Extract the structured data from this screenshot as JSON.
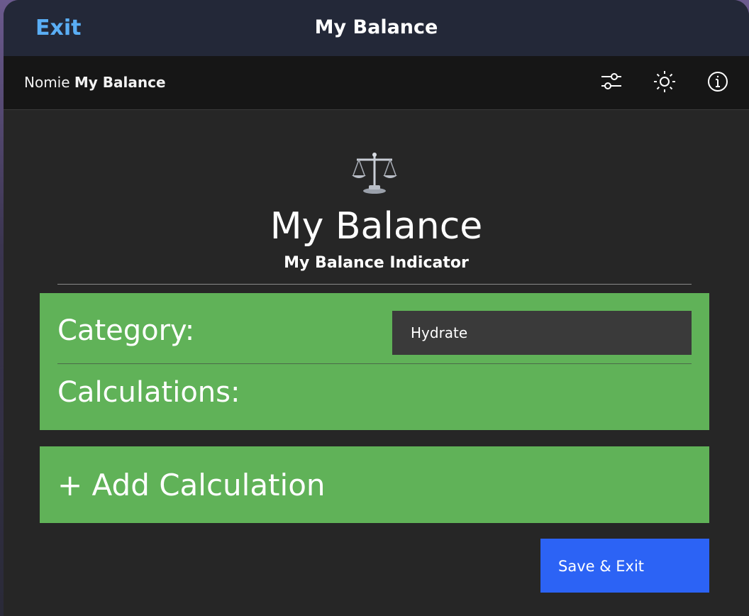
{
  "window": {
    "exit_label": "Exit",
    "title": "My Balance"
  },
  "appbar": {
    "brand_prefix": "Nomie",
    "brand_name": "My Balance",
    "icons": [
      "sliders-icon",
      "brightness-icon",
      "info-icon"
    ]
  },
  "plugin": {
    "icon": "balance-scale-icon",
    "title": "My Balance",
    "subtitle": "My Balance Indicator"
  },
  "form": {
    "category_label": "Category:",
    "category_value": "Hydrate",
    "calculations_label": "Calculations:",
    "add_calculation_label": "+ Add Calculation",
    "save_label": "Save & Exit"
  },
  "colors": {
    "accent_link": "#5aaef5",
    "card_green": "#60b258",
    "save_blue": "#2c63f5"
  }
}
